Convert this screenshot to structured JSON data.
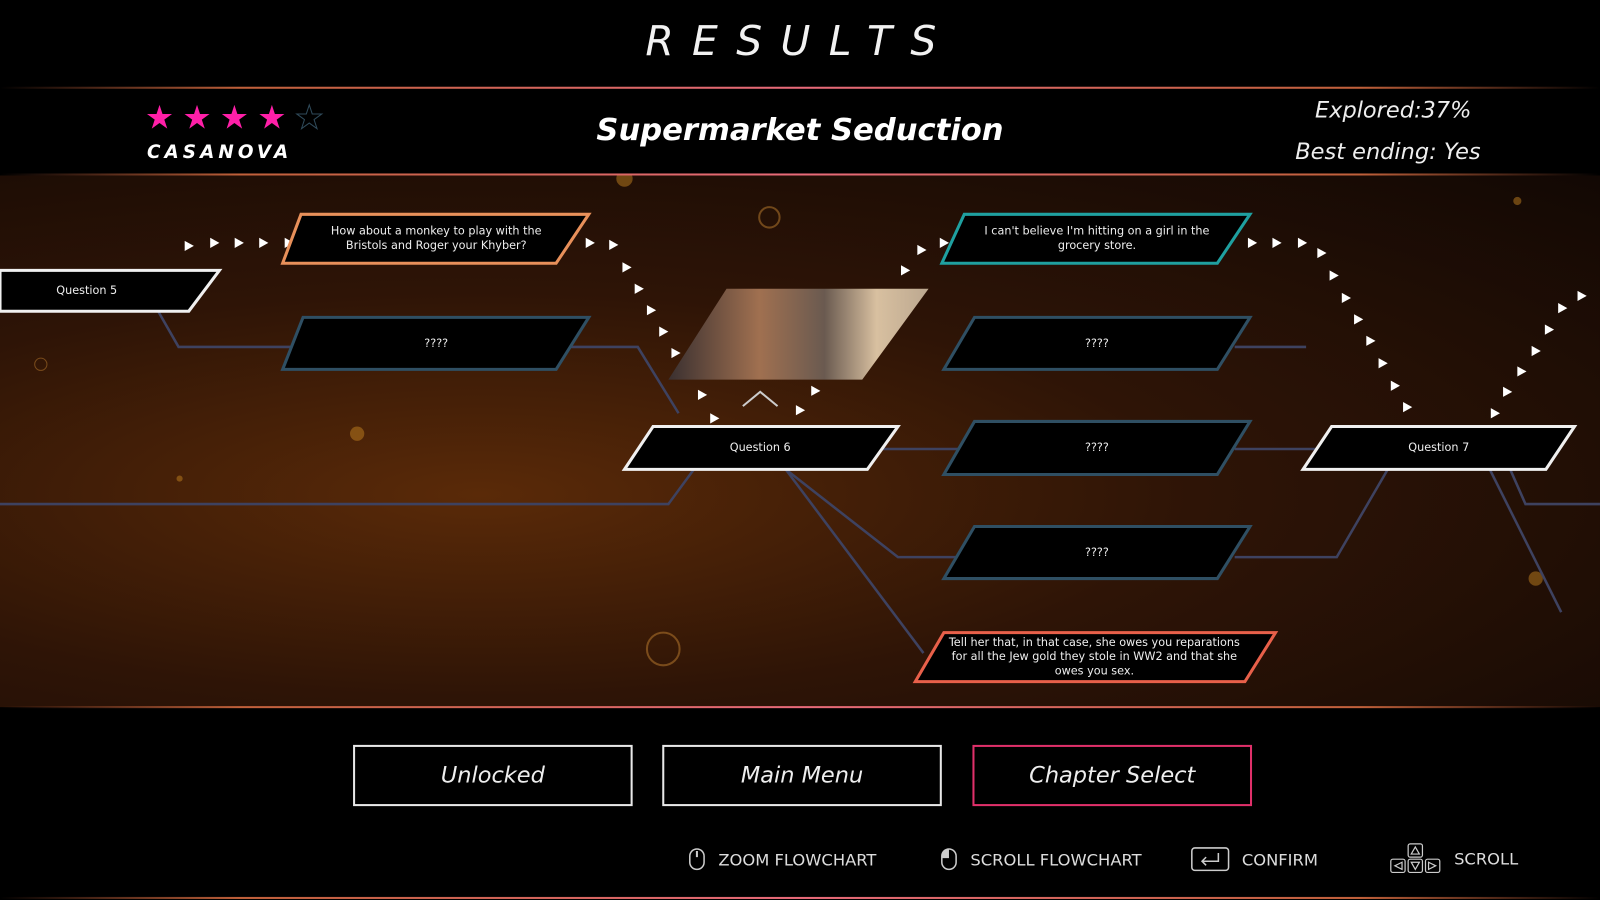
{
  "header": {
    "title": "RESULTS",
    "rank": "CASANOVA",
    "rating": 4,
    "max_rating": 5,
    "chapter_title": "Supermarket Seduction",
    "explored": "Explored:37%",
    "best_ending": "Best ending: Yes"
  },
  "colors": {
    "star": "#ff1fa8",
    "chosen_orange": "#e8905a",
    "chosen_teal": "#1fa0a0",
    "chosen_red": "#e8604a",
    "locked": "#2f4f63",
    "selected_button": "#e0306a"
  },
  "flowchart": {
    "question5": "Question 5",
    "question6": "Question 6",
    "question7": "Question 7",
    "q5_answer_chosen": "How about a monkey to play with the Bristols and Roger your Khyber?",
    "q5_answer_locked": "????",
    "q6_answer_chosen": "I can't believe I'm hitting on a girl in the grocery store.",
    "q6_answer_locked_1": "????",
    "q6_answer_locked_2": "????",
    "q6_answer_locked_3": "????",
    "q6_answer_alt": "Tell her that, in that case, she owes you reparations for all the Jew gold they stole in WW2 and that she owes you sex."
  },
  "buttons": {
    "unlocked": "Unlocked",
    "main_menu": "Main Menu",
    "chapter_select": "Chapter Select"
  },
  "hints": [
    {
      "icon": "mouse-wheel-icon",
      "label": "ZOOM FLOWCHART"
    },
    {
      "icon": "mouse-left-icon",
      "label": "SCROLL FLOWCHART"
    },
    {
      "icon": "enter-key-icon",
      "label": "CONFIRM"
    },
    {
      "icon": "arrow-keys-icon",
      "label": "SCROLL"
    }
  ]
}
